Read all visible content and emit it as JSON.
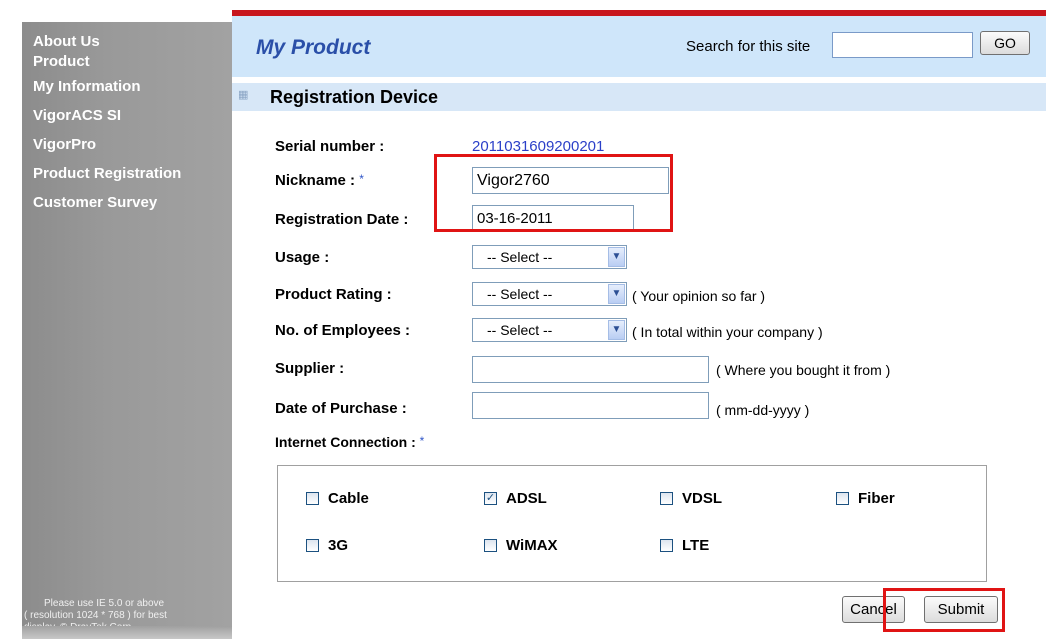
{
  "sidebar": {
    "items": [
      {
        "label": "About Us"
      },
      {
        "label": "Product"
      },
      {
        "label": "My Information"
      },
      {
        "label": "VigorACS SI"
      },
      {
        "label": "VigorPro"
      },
      {
        "label": "Product Registration"
      },
      {
        "label": "Customer Survey"
      }
    ],
    "note_lines": [
      "Please use IE 5.0 or above",
      "( resolution 1024 * 768 ) for best",
      "display. © DrayTek Corp."
    ]
  },
  "header": {
    "title": "My Product",
    "search_label": "Search for this site",
    "search_value": "",
    "go_label": "GO"
  },
  "section": {
    "title": "Registration Device"
  },
  "form": {
    "serial_label": "Serial number :",
    "serial_value": "2011031609200201",
    "nickname_label": "Nickname :",
    "nickname_value": "Vigor2760",
    "reg_date_label": "Registration Date :",
    "reg_date_value": "03-16-2011",
    "usage_label": "Usage :",
    "usage_value": "-- Select --",
    "rating_label": "Product Rating :",
    "rating_value": "-- Select --",
    "rating_hint": "( Your opinion so far )",
    "employees_label": "No. of Employees :",
    "employees_value": "-- Select --",
    "employees_hint": "( In total within your company )",
    "supplier_label": "Supplier :",
    "supplier_value": "",
    "supplier_hint": "( Where you bought it from )",
    "purchase_label": "Date of Purchase :",
    "purchase_value": "",
    "purchase_hint": "( mm-dd-yyyy )",
    "connection_label": "Internet Connection :",
    "required_mark": "*"
  },
  "connections": [
    {
      "label": "Cable",
      "checked": false
    },
    {
      "label": "ADSL",
      "checked": true
    },
    {
      "label": "VDSL",
      "checked": false
    },
    {
      "label": "Fiber",
      "checked": false
    },
    {
      "label": "3G",
      "checked": false
    },
    {
      "label": "WiMAX",
      "checked": false
    },
    {
      "label": "LTE",
      "checked": false
    }
  ],
  "buttons": {
    "cancel": "Cancel",
    "submit": "Submit"
  },
  "colors": {
    "accent_red": "#c8161d",
    "annotation_red": "#e01414",
    "title_blue": "#2a4fa8",
    "link_blue": "#2a3fc8"
  }
}
